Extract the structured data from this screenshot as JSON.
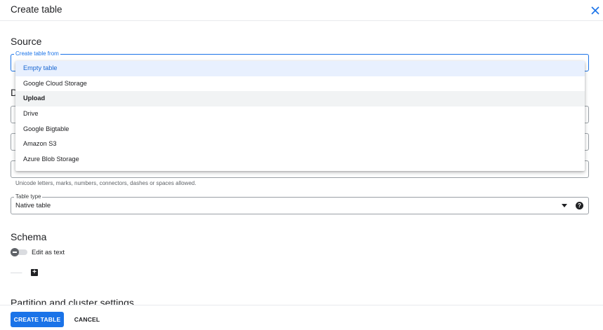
{
  "dialog": {
    "title": "Create table",
    "close_icon": "close-icon"
  },
  "source": {
    "title": "Source",
    "create_from_legend": "Create table from",
    "create_from_options": [
      "Empty table",
      "Google Cloud Storage",
      "Upload",
      "Drive",
      "Google Bigtable",
      "Amazon S3",
      "Azure Blob Storage"
    ],
    "selected_option": "Empty table",
    "hovered_option": "Upload"
  },
  "destination": {
    "title_partial": "D",
    "table_name_helper": "Unicode letters, marks, numbers, connectors, dashes or spaces allowed.",
    "table_type_legend": "Table type",
    "table_type_value": "Native table",
    "help_icon": "help-icon"
  },
  "schema": {
    "title": "Schema",
    "edit_as_text_label": "Edit as text",
    "edit_as_text_enabled": false,
    "add_field_icon": "add-box-icon"
  },
  "partition": {
    "title": "Partition and cluster settings"
  },
  "footer": {
    "create_label": "CREATE TABLE",
    "cancel_label": "CANCEL"
  },
  "colors": {
    "accent": "#1a73e8",
    "selected_bg": "#e8f0fe",
    "hover_bg": "#f1f3f4"
  }
}
